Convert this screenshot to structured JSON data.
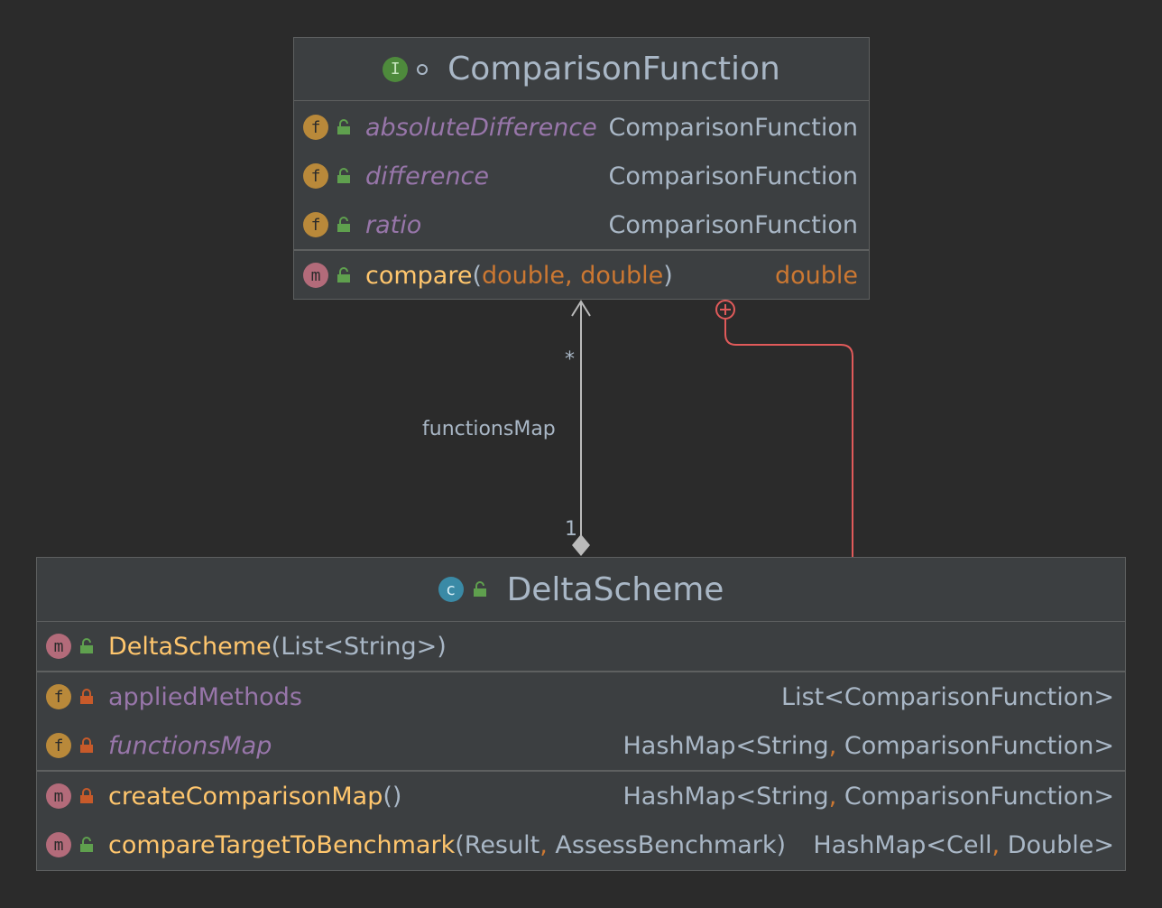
{
  "interface_box": {
    "title": "ComparisonFunction",
    "kind_letter": "I",
    "fields": [
      {
        "name": "absoluteDifference",
        "type": "ComparisonFunction"
      },
      {
        "name": "difference",
        "type": "ComparisonFunction"
      },
      {
        "name": "ratio",
        "type": "ComparisonFunction"
      }
    ],
    "method": {
      "name": "compare",
      "open": "(",
      "p1": "double",
      "comma": ",",
      "p2": "double",
      "close": ")",
      "return_type": "double"
    }
  },
  "class_box": {
    "title": "DeltaScheme",
    "kind_letter": "c",
    "constructor": {
      "name": "DeltaScheme",
      "open": "(",
      "param": "List<String>",
      "close": ")"
    },
    "fields": [
      {
        "name": "appliedMethods",
        "type": "List<ComparisonFunction>"
      },
      {
        "name": "functionsMap",
        "type_a": "HashMap<String",
        "comma": ",",
        "type_b": " ComparisonFunction>"
      }
    ],
    "methods": [
      {
        "name": "createComparisonMap",
        "params": "()",
        "type_a": "HashMap<String",
        "comma": ",",
        "type_b": " ComparisonFunction>"
      },
      {
        "name": "compareTargetToBenchmark",
        "open": "(",
        "p1": "Result",
        "comma": ",",
        "p2": " AssessBenchmark",
        "close": ")",
        "type_a": "HashMap<Cell",
        "comma2": ",",
        "type_b": " Double>"
      }
    ]
  },
  "association": {
    "label": "functionsMap",
    "multiplicity_target": "*",
    "multiplicity_source": "1"
  },
  "colors": {
    "background": "#2b2b2b",
    "box": "#3c3f41",
    "inner_class_link": "#e05a5a",
    "association_line": "#bbbbbb"
  }
}
